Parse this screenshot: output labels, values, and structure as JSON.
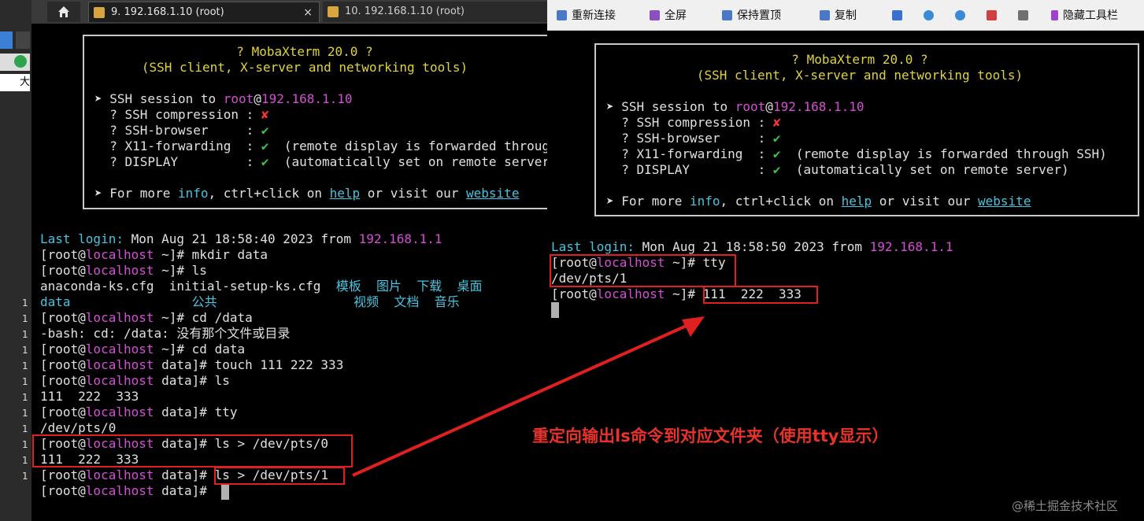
{
  "tabs": [
    {
      "label": "9. 192.168.1.10 (root)",
      "close": "×"
    },
    {
      "label": "10. 192.168.1.10 (root)",
      "close": "×"
    }
  ],
  "left_strip": {
    "badge_text": "大",
    "line_marker": "1"
  },
  "toolbar": {
    "items": [
      {
        "label": "重新连接",
        "icon": "doc-icon"
      },
      {
        "label": "全屏",
        "icon": "fullscreen-icon"
      },
      {
        "label": "保持置顶",
        "icon": "pin-icon"
      },
      {
        "label": "复制",
        "icon": "copy-icon"
      },
      {
        "label": "",
        "icon": "edit-icon"
      },
      {
        "label": "",
        "icon": "zoom-in-icon"
      },
      {
        "label": "",
        "icon": "zoom-out-icon"
      },
      {
        "label": "",
        "icon": "save-icon"
      },
      {
        "label": "",
        "icon": "print-icon"
      },
      {
        "label": "隐藏工具栏",
        "icon": "lightning-icon"
      }
    ]
  },
  "banner": {
    "title": "? MobaXterm 20.0 ?",
    "subtitle": "(SSH client, X-server and networking tools)",
    "session_prefix": "➤ SSH session to ",
    "session_user": "root",
    "session_at": "@",
    "session_host": "192.168.1.10",
    "compression_label": "  ? SSH compression : ",
    "compression_mark": "✘",
    "browser_label": "  ? SSH-browser     : ",
    "browser_mark": "✔",
    "x11_label": "  ? X11-forwarding  : ",
    "x11_mark": "✔",
    "x11_note": "  (remote display is forwarded through SSH)",
    "display_label": "  ? DISPLAY         : ",
    "display_mark": "✔",
    "display_note": "  (automatically set on remote server)",
    "more_prefix": "➤ For more ",
    "more_info": "info",
    "more_mid": ", ctrl+click on ",
    "more_help": "help",
    "more_or": " or visit our ",
    "more_website": "website"
  },
  "left_terminal": {
    "last_login_label": "Last login:",
    "last_login_date": " Mon Aug 21 18:58:40 2023 from ",
    "last_login_ip": "192.168.1.1",
    "prompt_open": "[root@",
    "prompt_host": "localhost",
    "prompt_home": " ~]# ",
    "prompt_data": " data]# ",
    "cmd1": "mkdir data",
    "cmd2": "ls",
    "ls_row1_file1": "anaconda-ks.cfg  ",
    "ls_row1_file2": "initial-setup-ks.cfg  ",
    "ls_row1_dirs": "模板  图片  下载  桌面",
    "ls_row2_data": "data",
    "ls_row2_gap": "                ",
    "ls_row2_dir1": "公共",
    "ls_row2_gap2": "                  ",
    "ls_row2_dirs": "视频  文档  音乐",
    "cmd3": "cd /data",
    "err": "-bash: cd: /data: 没有那个文件或目录",
    "cmd4": "cd data",
    "cmd5": "touch 111 222 333",
    "cmd6": "ls",
    "out6": "111  222  333",
    "cmd7": "tty",
    "out7": "/dev/pts/0",
    "cmd8": "ls > /dev/pts/0",
    "out8": "111  222  333",
    "cmd9": "ls > /dev/pts/1"
  },
  "right_terminal": {
    "last_login_label": "Last login:",
    "last_login_date": " Mon Aug 21 18:58:50 2023 from ",
    "last_login_ip": "192.168.1.1",
    "cmd1": "tty",
    "out1": "/dev/pts/1",
    "received": "111  222  333"
  },
  "annotation": "重定向输出ls命令到对应文件夹（使用tty显示）",
  "watermark": "@稀土掘金技术社区",
  "colors": {
    "green": "#3ec24b",
    "yellow": "#dfd33a",
    "magenta": "#d44fd4",
    "cyan": "#48c4e0",
    "red": "#e02020"
  }
}
